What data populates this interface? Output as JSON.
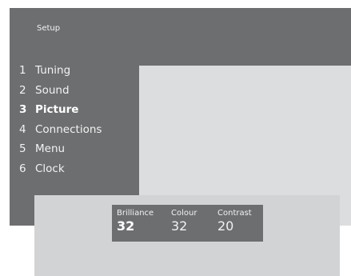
{
  "screen": {
    "title": "Setup"
  },
  "menu": {
    "items": [
      {
        "number": "1",
        "label": "Tuning",
        "selected": false
      },
      {
        "number": "2",
        "label": "Sound",
        "selected": false
      },
      {
        "number": "3",
        "label": "Picture",
        "selected": true
      },
      {
        "number": "4",
        "label": "Connections",
        "selected": false
      },
      {
        "number": "5",
        "label": "Menu",
        "selected": false
      },
      {
        "number": "6",
        "label": "Clock",
        "selected": false
      }
    ]
  },
  "picture_settings": {
    "brilliance": {
      "label": "Brilliance",
      "value": "32",
      "active": true
    },
    "colour": {
      "label": "Colour",
      "value": "32",
      "active": false
    },
    "contrast": {
      "label": "Contrast",
      "value": "20",
      "active": false
    }
  },
  "colors": {
    "menu_background": "#6d6e70",
    "content_background": "#dcddde",
    "bottom_panel_background": "#d2d3d4",
    "text": "#f2f2f2"
  }
}
